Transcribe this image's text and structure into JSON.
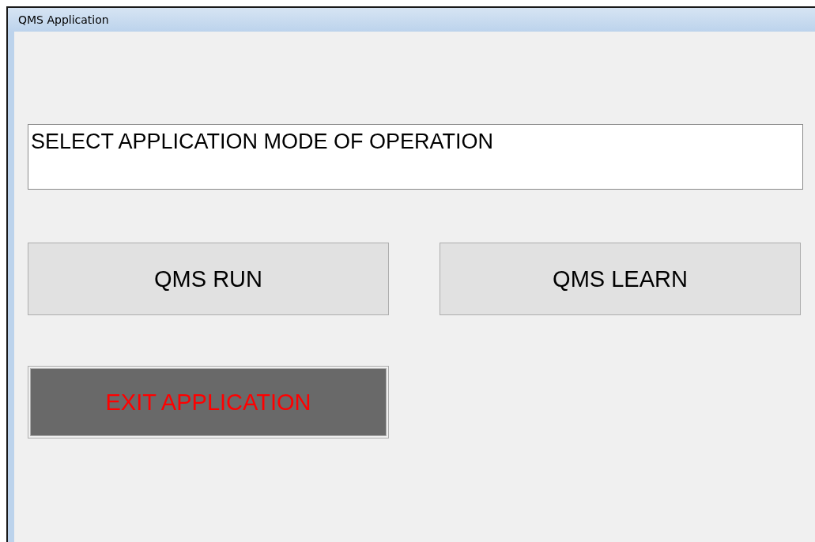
{
  "window": {
    "title": "QMS Application"
  },
  "prompt": {
    "value": "SELECT APPLICATION MODE OF OPERATION"
  },
  "buttons": [
    {
      "label": "QMS RUN",
      "kind": "mode"
    },
    {
      "label": "QMS LEARN",
      "kind": "mode"
    },
    {
      "label": "EXIT APPLICATION",
      "kind": "exit"
    }
  ]
}
